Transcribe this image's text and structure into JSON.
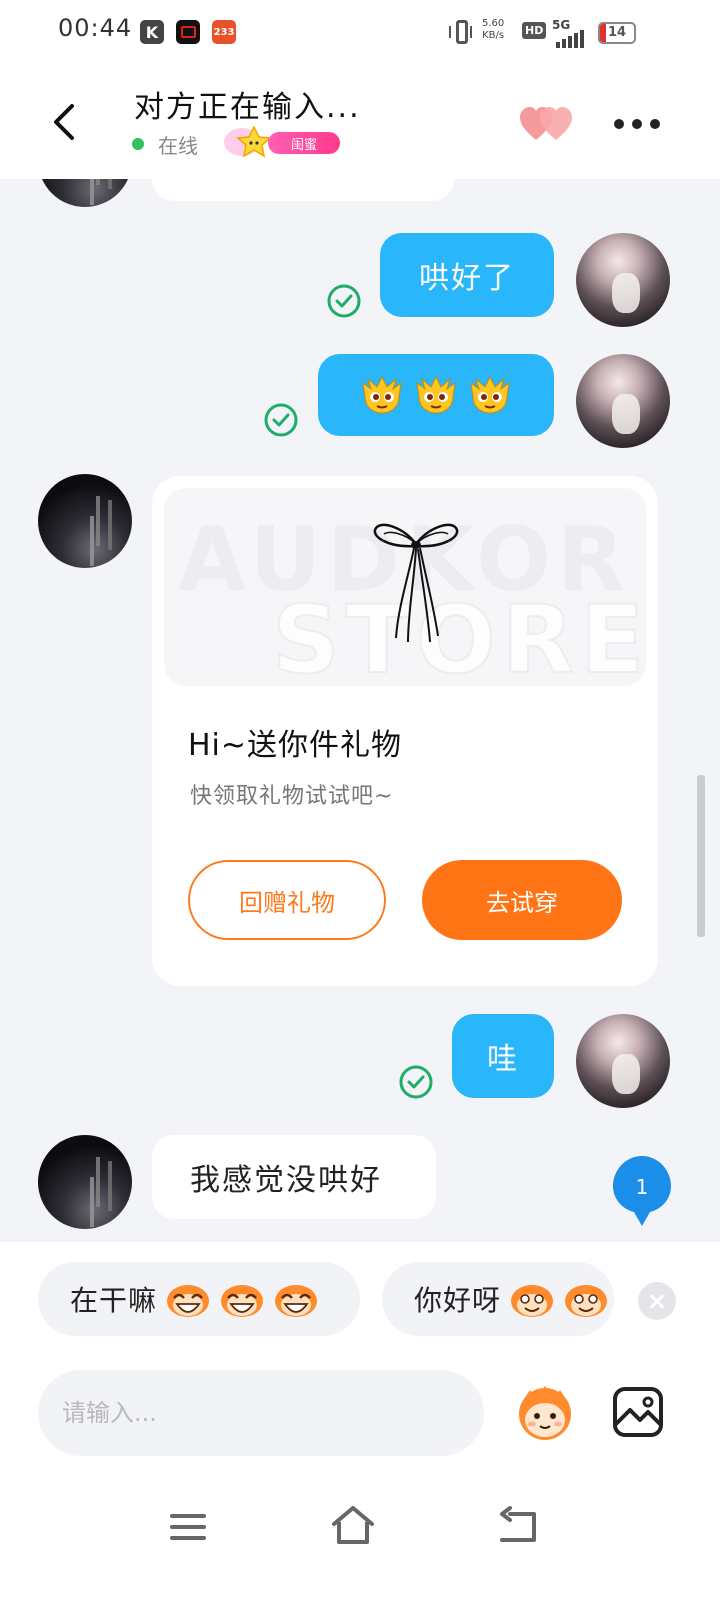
{
  "status_bar": {
    "time": "00:44",
    "app_icons": [
      "K",
      "",
      "233"
    ],
    "net_speed_value": "5.60",
    "net_speed_unit": "KB/s",
    "hd": "HD",
    "network": "5G",
    "battery": "14"
  },
  "header": {
    "title": "对方正在输入...",
    "status": "在线",
    "badge": "闺蜜"
  },
  "messages": {
    "m1": "哄好了",
    "m3": "哇",
    "m4": "我感觉没哄好"
  },
  "gift_card": {
    "watermark_top": "AUDKOR",
    "watermark_bottom": "STORE",
    "title": "Hi~送你件礼物",
    "subtitle": "快领取礼物试试吧~",
    "return_button": "回赠礼物",
    "try_button": "去试穿"
  },
  "unread_count": "1",
  "quick_replies": [
    "在干嘛",
    "你好呀"
  ],
  "input": {
    "placeholder": "请输入..."
  },
  "colors": {
    "self_bubble": "#2ab6fa",
    "accent_orange": "#ff7414",
    "online_green": "#31c259",
    "check_green": "#1fae6a"
  }
}
